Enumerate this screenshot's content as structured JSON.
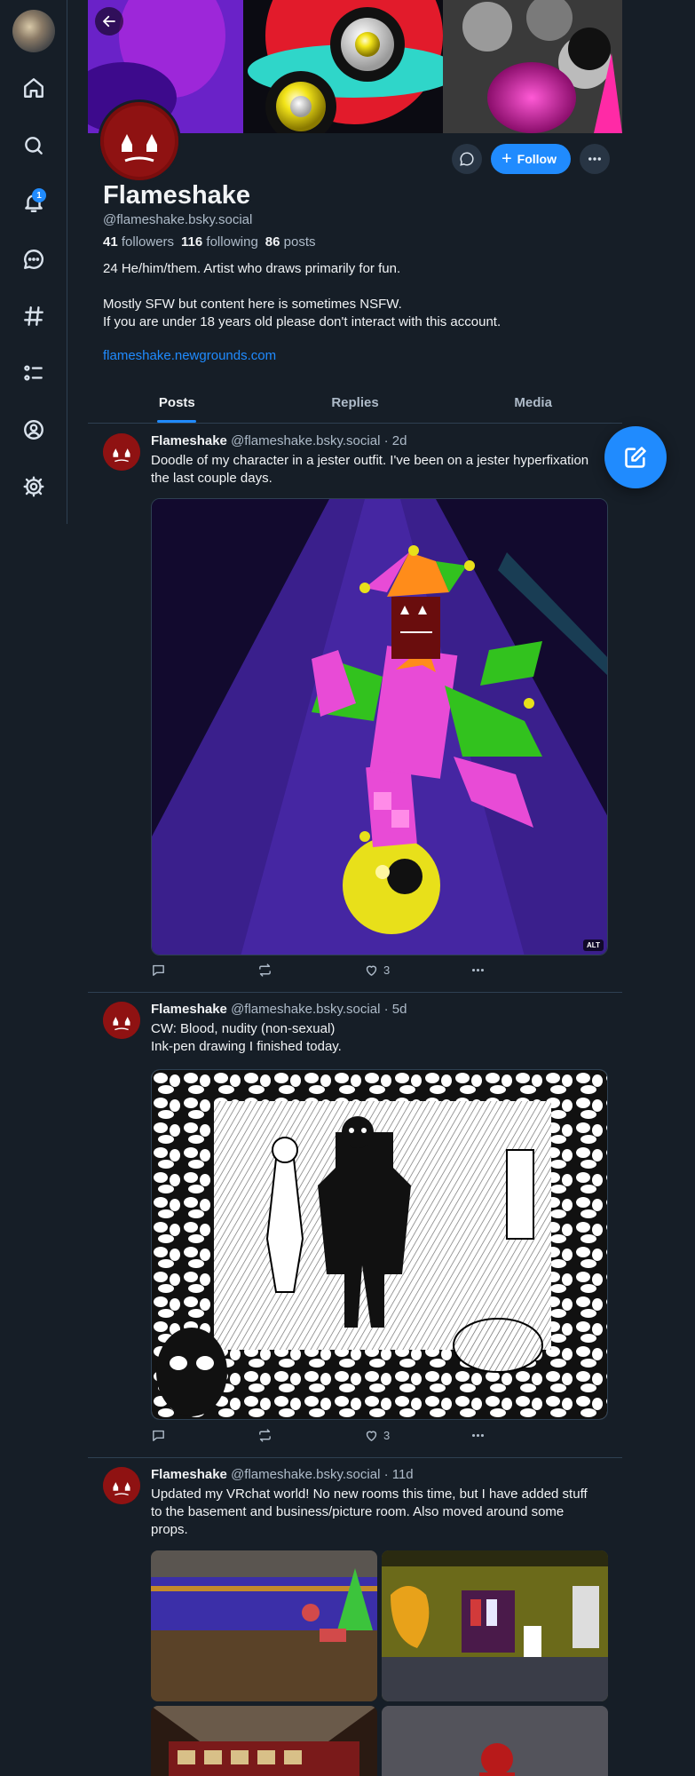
{
  "nav": {
    "notification_count": "1",
    "items": [
      "home",
      "search",
      "notifications",
      "chat",
      "feeds",
      "lists",
      "profile",
      "settings"
    ]
  },
  "profile": {
    "display_name": "Flameshake",
    "handle": "@flameshake.bsky.social",
    "followers_count": "41",
    "followers_label": "followers",
    "following_count": "116",
    "following_label": "following",
    "posts_count": "86",
    "posts_label": "posts",
    "bio_line1": "24 He/him/them. Artist who draws primarily for fun.",
    "bio_line2": "Mostly SFW but content here is sometimes NSFW.",
    "bio_line3": "If you are under 18 years old please don't interact with this account.",
    "link": "flameshake.newgrounds.com",
    "follow_label": "Follow"
  },
  "tabs": [
    {
      "label": "Posts",
      "active": true
    },
    {
      "label": "Replies",
      "active": false
    },
    {
      "label": "Media",
      "active": false
    }
  ],
  "posts": [
    {
      "author": "Flameshake",
      "meta": "@flameshake.bsky.social · 2d",
      "text": "Doodle of my character in a jester outfit. I've been on a jester hyperfixation the last couple days.",
      "likes": "3",
      "alt": "ALT"
    },
    {
      "author": "Flameshake",
      "meta": "@flameshake.bsky.social · 5d",
      "text_line1": "CW: Blood, nudity (non-sexual)",
      "text_line2": "Ink-pen drawing I finished today.",
      "likes": "3"
    },
    {
      "author": "Flameshake",
      "meta": "@flameshake.bsky.social · 11d",
      "text": "Updated my VRchat world! No new rooms this time, but I have added stuff to the basement and business/picture room. Also moved around some props."
    }
  ],
  "colors": {
    "background": "#161e27",
    "accent": "#208bfe",
    "border": "#2e4052",
    "muted_text": "#aebbc9"
  }
}
